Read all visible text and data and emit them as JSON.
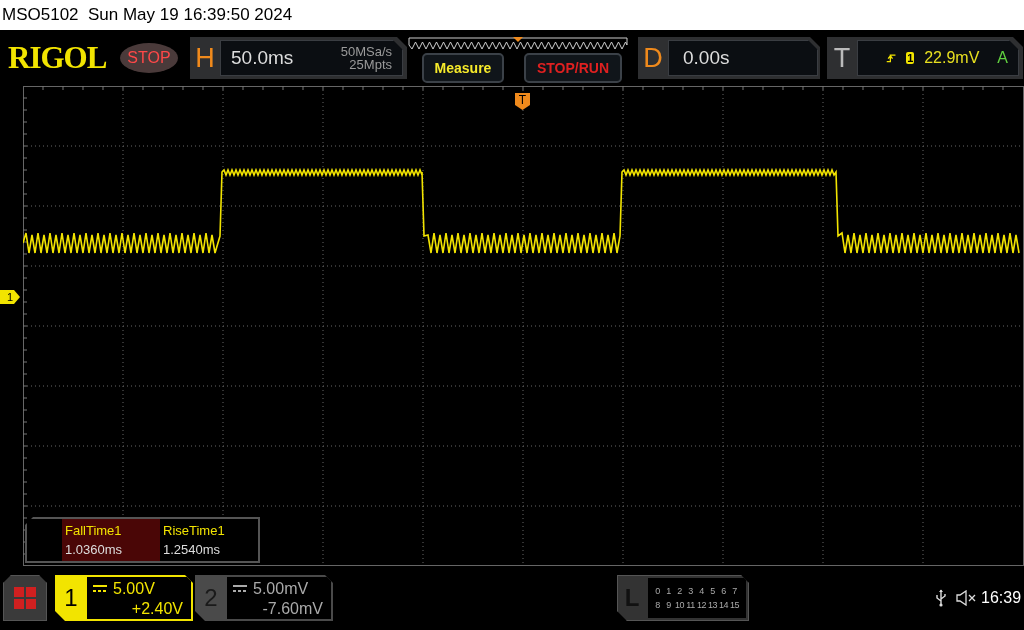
{
  "title_bar": {
    "text": "MSO5102  Sun May 19 16:39:50 2024"
  },
  "toolbar": {
    "logo": "RIGOL",
    "run_state": {
      "label": "STOP",
      "kind": "stop"
    },
    "horizontal": {
      "letter": "H",
      "timebase": "50.0ms",
      "sample_rate": "50MSa/s",
      "memory_depth": "25Mpts"
    },
    "buttons": [
      {
        "label": "Measure",
        "kind": "measure"
      },
      {
        "label": "STOP/RUN",
        "kind": "stoprun"
      }
    ],
    "delay": {
      "letter": "D",
      "value": "0.00s"
    },
    "trigger": {
      "letter": "T",
      "source": "1",
      "level": "22.9mV",
      "mode": "A"
    }
  },
  "display": {
    "channel_marker": "1",
    "trigger_marker": "T",
    "measurements": [
      {
        "name": "FallTime1",
        "value": "1.0360ms",
        "selected": true
      },
      {
        "name": "RiseTime1",
        "value": "1.2540ms",
        "selected": false
      }
    ]
  },
  "bottom_bar": {
    "channels": [
      {
        "number": "1",
        "scale": "5.00V",
        "offset": "+2.40V",
        "selected": true
      },
      {
        "number": "2",
        "scale": "5.00mV",
        "offset": "-7.60mV",
        "selected": false
      }
    ],
    "logic": {
      "letter": "L",
      "rows": [
        [
          "0",
          "1",
          "2",
          "3",
          "4",
          "5",
          "6",
          "7"
        ],
        [
          "8",
          "9",
          "10",
          "11",
          "12",
          "13",
          "14",
          "15"
        ]
      ]
    },
    "clock": "16:39"
  }
}
